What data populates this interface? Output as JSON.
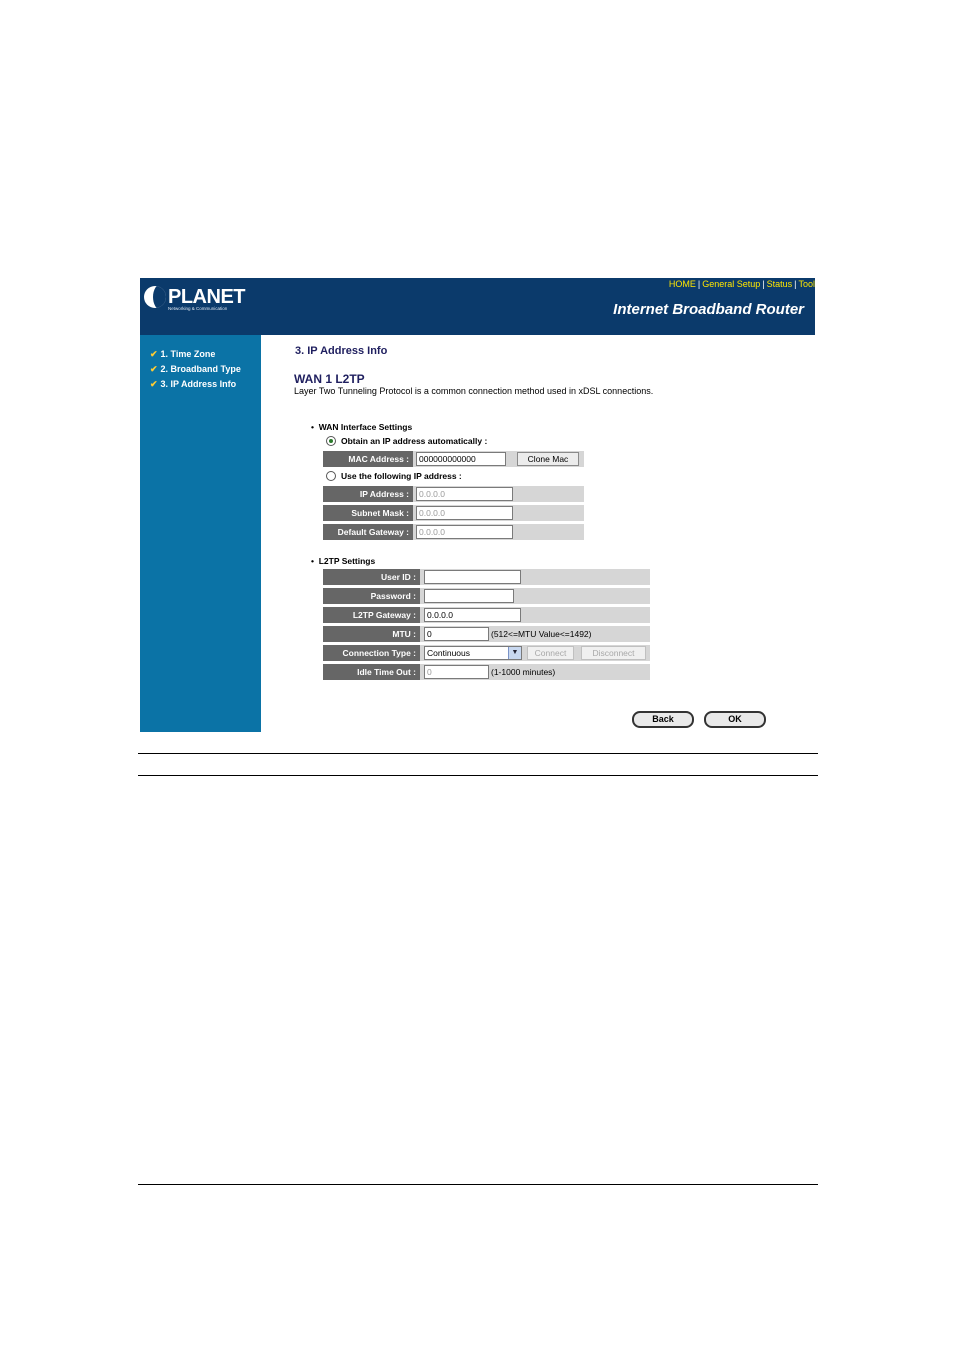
{
  "header": {
    "brand": "PLANET",
    "brand_sub": "Networking & Communication",
    "product": "Internet Broadband Router",
    "nav": [
      "HOME",
      "General Setup",
      "Status",
      "Tool"
    ]
  },
  "sidebar": {
    "steps": [
      "1. Time Zone",
      "2. Broadband Type",
      "3. IP Address Info"
    ]
  },
  "main": {
    "section_title": "3. IP Address Info",
    "wan_title": "WAN 1 L2TP",
    "wan_desc": "Layer Two Tunneling Protocol is a common connection method used in xDSL connections.",
    "wan_settings_heading": "WAN Interface Settings",
    "obtain_auto_label": "Obtain an IP address automatically :",
    "mac_label": "MAC Address :",
    "mac_value": "000000000000",
    "clone_mac_button": "Clone Mac",
    "use_following_label": "Use the following IP address :",
    "ip_label": "IP Address :",
    "ip_value": "0.0.0.0",
    "subnet_label": "Subnet Mask :",
    "subnet_value": "0.0.0.0",
    "gateway_label": "Default Gateway :",
    "gateway_value": "0.0.0.0",
    "l2tp_heading": "L2TP Settings",
    "user_id_label": "User ID :",
    "user_id_value": "",
    "password_label": "Password :",
    "password_value": "",
    "l2tp_gateway_label": "L2TP Gateway :",
    "l2tp_gateway_value": "0.0.0.0",
    "mtu_label": "MTU :",
    "mtu_value": "0",
    "mtu_hint": "(512<=MTU Value<=1492)",
    "conn_type_label": "Connection Type :",
    "conn_type_value": "Continuous",
    "connect_button": "Connect",
    "disconnect_button": "Disconnect",
    "idle_label": "Idle Time Out :",
    "idle_value": "0",
    "idle_hint": "(1-1000 minutes)",
    "back_button": "Back",
    "ok_button": "OK"
  },
  "colors": {
    "header_bg": "#0b3a6b",
    "sidebar_bg": "#0b73a6",
    "label_bg": "#666666",
    "row_bg": "#d6d6d6",
    "nav_link": "#ffe600"
  },
  "icons": [
    "planet-logo-icon",
    "check-icon",
    "radio-icon",
    "dropdown-arrow-icon"
  ]
}
